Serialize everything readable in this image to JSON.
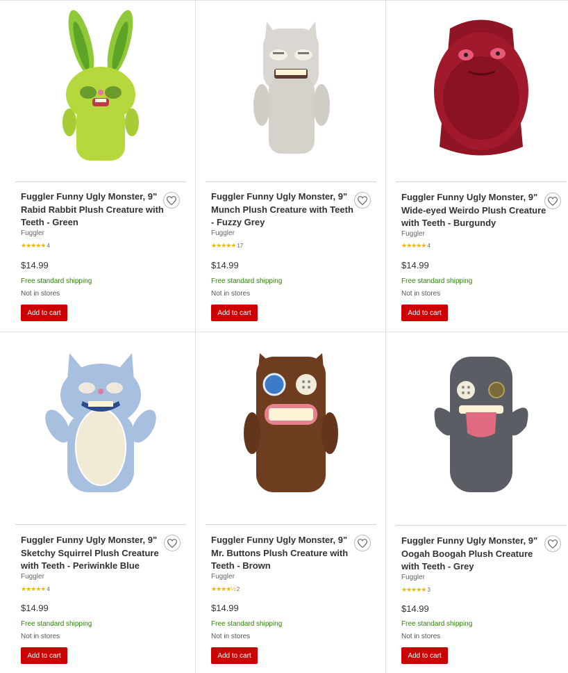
{
  "products": [
    {
      "title": "Fuggler Funny Ugly Monster, 9\" Rabid Rabbit Plush Creature with Teeth - Green",
      "brand": "Fuggler",
      "rating_stars": "★★★★★",
      "review_count": "4",
      "price": "$14.99",
      "shipping": "Free standard shipping",
      "availability": "Not in stores",
      "cta": "Add to cart",
      "image": "green rabbit plush"
    },
    {
      "title": "Fuggler Funny Ugly Monster, 9\" Munch Plush Creature with Teeth - Fuzzy Grey",
      "brand": "Fuggler",
      "rating_stars": "★★★★★",
      "review_count": "17",
      "price": "$14.99",
      "shipping": "Free standard shipping",
      "availability": "Not in stores",
      "cta": "Add to cart",
      "image": "fuzzy grey plush"
    },
    {
      "title": "Fuggler Funny Ugly Monster, 9\" Wide-eyed Weirdo Plush Creature with Teeth - Burgundy",
      "brand": "Fuggler",
      "rating_stars": "★★★★★",
      "review_count": "4",
      "price": "$14.99",
      "shipping": "Free standard shipping",
      "availability": "Not in stores",
      "cta": "Add to cart",
      "image": "burgundy furry plush"
    },
    {
      "title": "Fuggler Funny Ugly Monster, 9\" Sketchy Squirrel Plush Creature with Teeth - Periwinkle Blue",
      "brand": "Fuggler",
      "rating_stars": "★★★★★",
      "review_count": "4",
      "price": "$14.99",
      "shipping": "Free standard shipping",
      "availability": "Not in stores",
      "cta": "Add to cart",
      "image": "periwinkle squirrel plush"
    },
    {
      "title": "Fuggler Funny Ugly Monster, 9\" Mr. Buttons Plush Creature with Teeth - Brown",
      "brand": "Fuggler",
      "rating_stars": "★★★★½",
      "review_count": "2",
      "price": "$14.99",
      "shipping": "Free standard shipping",
      "availability": "Not in stores",
      "cta": "Add to cart",
      "image": "brown buttons plush"
    },
    {
      "title": "Fuggler Funny Ugly Monster, 9\" Oogah Boogah Plush Creature with Teeth - Grey",
      "brand": "Fuggler",
      "rating_stars": "★★★★★",
      "review_count": "3",
      "price": "$14.99",
      "shipping": "Free standard shipping",
      "availability": "Not in stores",
      "cta": "Add to cart",
      "image": "grey tongue plush"
    }
  ],
  "colors": {
    "cta": "#cc0000",
    "shipping": "#2a8703",
    "stars": "#f2b400"
  }
}
